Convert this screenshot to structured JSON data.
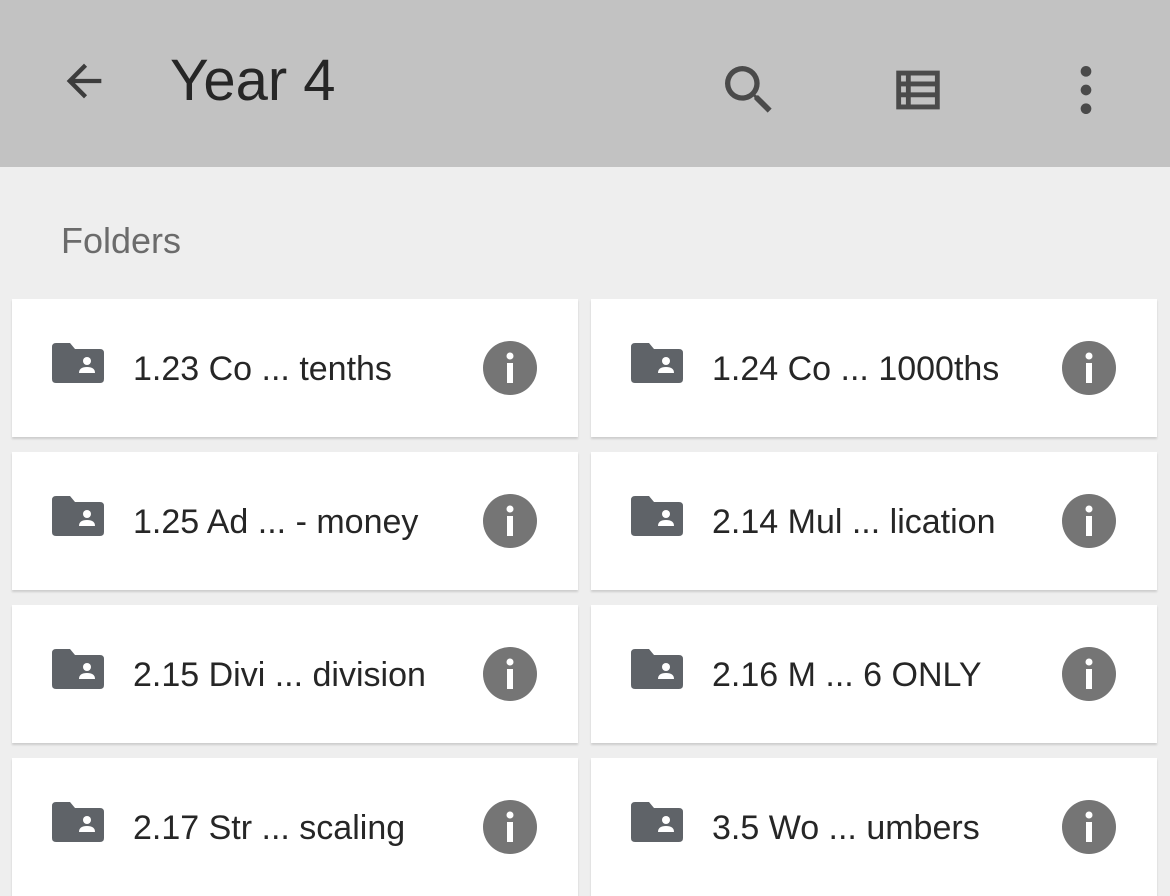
{
  "appbar": {
    "title": "Year 4",
    "back_icon": "arrow-back-icon",
    "search_icon": "search-icon",
    "view_icon": "list-view-icon",
    "more_icon": "more-vertical-icon",
    "background": "#c2c2c2"
  },
  "section": {
    "label": "Folders"
  },
  "folders": [
    {
      "name": "1.23 Co ... tenths"
    },
    {
      "name": "1.24 Co ... 1000ths"
    },
    {
      "name": "1.25 Ad ... - money"
    },
    {
      "name": "2.14 Mul ... lication"
    },
    {
      "name": "2.15 Divi ... division"
    },
    {
      "name": "2.16 M ... 6 ONLY"
    },
    {
      "name": "2.17 Str ... scaling"
    },
    {
      "name": "3.5 Wo ... umbers"
    }
  ],
  "colors": {
    "icon": "#5f6368",
    "info": "#757575",
    "page_bg": "#eeeeee"
  }
}
